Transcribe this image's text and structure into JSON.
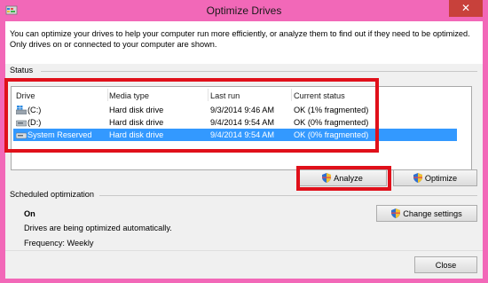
{
  "window": {
    "title": "Optimize Drives",
    "close_glyph": "✕"
  },
  "intro_text": "You can optimize your drives to help your computer run more efficiently, or analyze them to find out if they need to be optimized. Only drives on or connected to your computer are shown.",
  "status": {
    "group_label": "Status",
    "columns": [
      "Drive",
      "Media type",
      "Last run",
      "Current status"
    ],
    "rows": [
      {
        "drive": "(C:)",
        "media": "Hard disk drive",
        "last_run": "9/3/2014 9:46 AM",
        "status": "OK (1% fragmented)",
        "icon": "windows-drive-icon",
        "selected": false
      },
      {
        "drive": "(D:)",
        "media": "Hard disk drive",
        "last_run": "9/4/2014 9:54 AM",
        "status": "OK (0% fragmented)",
        "icon": "drive-icon",
        "selected": false
      },
      {
        "drive": "System Reserved",
        "media": "Hard disk drive",
        "last_run": "9/4/2014 9:54 AM",
        "status": "OK (0% fragmented)",
        "icon": "drive-icon",
        "selected": true
      }
    ],
    "analyze_label": "Analyze",
    "optimize_label": "Optimize"
  },
  "scheduled": {
    "group_label": "Scheduled optimization",
    "state": "On",
    "description": "Drives are being optimized automatically.",
    "frequency": "Frequency: Weekly",
    "change_settings_label": "Change settings"
  },
  "footer": {
    "close_label": "Close"
  },
  "colors": {
    "border_accent": "#f268b8",
    "selection": "#3399ff",
    "highlight_box": "#e0101a",
    "close_button": "#c8413b"
  }
}
